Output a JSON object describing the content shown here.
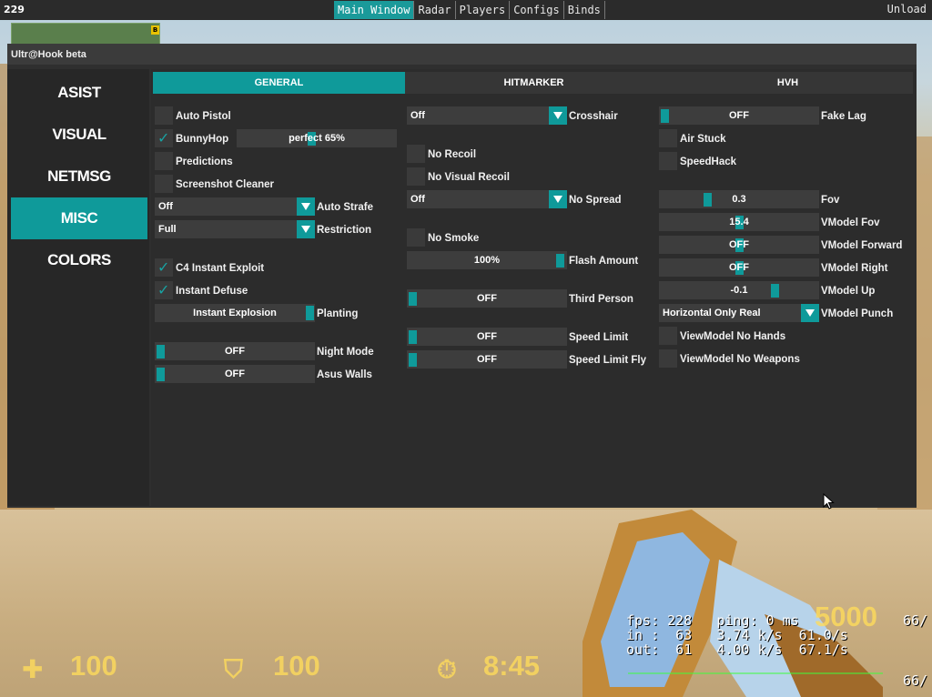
{
  "topbar": {
    "fps": "229",
    "tabs": [
      "Main Window",
      "Radar",
      "Players",
      "Configs",
      "Binds"
    ],
    "active_tab": "Main Window",
    "unload": "Unload"
  },
  "radar": {
    "site_label": "B"
  },
  "window": {
    "title": "Ultr@Hook beta",
    "sidebar": [
      "ASIST",
      "VISUAL",
      "NETMSG",
      "MISC",
      "COLORS"
    ],
    "active_sidebar": "MISC",
    "tabs": [
      "GENERAL",
      "HITMARKER",
      "HVH"
    ],
    "active_tab": "GENERAL"
  },
  "col1": {
    "auto_pistol": {
      "label": "Auto Pistol",
      "checked": false
    },
    "bunnyhop": {
      "label": "BunnyHop",
      "checked": true,
      "slider_text": "perfect 65%",
      "slider_percent": 65
    },
    "predictions": {
      "label": "Predictions",
      "checked": false
    },
    "screenshot_cleaner": {
      "label": "Screenshot Cleaner",
      "checked": false
    },
    "auto_strafe": {
      "label": "Auto Strafe",
      "value": "Off"
    },
    "restriction": {
      "label": "Restriction",
      "value": "Full"
    },
    "c4_instant_exploit": {
      "label": "C4 Instant Exploit",
      "checked": true
    },
    "instant_defuse": {
      "label": "Instant Defuse",
      "checked": true
    },
    "planting": {
      "label": "Planting",
      "button_text": "Instant Explosion"
    },
    "night_mode": {
      "label": "Night Mode",
      "value": "OFF"
    },
    "asus_walls": {
      "label": "Asus Walls",
      "value": "OFF"
    }
  },
  "col2": {
    "crosshair": {
      "label": "Crosshair",
      "value": "Off"
    },
    "no_recoil": {
      "label": "No Recoil",
      "checked": false
    },
    "no_visual_recoil": {
      "label": "No Visual Recoil",
      "checked": false
    },
    "no_spread": {
      "label": "No Spread",
      "value": "Off"
    },
    "no_smoke": {
      "label": "No Smoke",
      "checked": false
    },
    "flash_amount": {
      "label": "Flash Amount",
      "value": "100%"
    },
    "third_person": {
      "label": "Third Person",
      "value": "OFF"
    },
    "speed_limit": {
      "label": "Speed Limit",
      "value": "OFF"
    },
    "speed_limit_fly": {
      "label": "Speed Limit Fly",
      "value": "OFF"
    }
  },
  "col3": {
    "fake_lag": {
      "label": "Fake Lag",
      "value": "OFF"
    },
    "air_stuck": {
      "label": "Air Stuck",
      "checked": false
    },
    "speedhack": {
      "label": "SpeedHack",
      "checked": false
    },
    "fov": {
      "label": "Fov",
      "value": "0.3"
    },
    "vmodel_fov": {
      "label": "VModel Fov",
      "value": "15.4"
    },
    "vmodel_forward": {
      "label": "VModel Forward",
      "value": "OFF"
    },
    "vmodel_right": {
      "label": "VModel Right",
      "value": "OFF"
    },
    "vmodel_up": {
      "label": "VModel Up",
      "value": "-0.1"
    },
    "vmodel_punch": {
      "label": "VModel Punch",
      "value": "Horizontal Only Real"
    },
    "viewmodel_no_hands": {
      "label": "ViewModel No Hands",
      "checked": false
    },
    "viewmodel_no_weapons": {
      "label": "ViewModel No Weapons",
      "checked": false
    }
  },
  "hud": {
    "health": "100",
    "armor": "100",
    "time": "8:45",
    "money": "5000",
    "netgraph_line1": "fps: 228   ping: 0 ms",
    "netgraph_line2": "in :  63   3.74 k/s  61.0/s",
    "netgraph_line3": "out:  61   4.00 k/s  67.1/s",
    "ammo_top": "66/",
    "ammo_bottom": "66/"
  }
}
